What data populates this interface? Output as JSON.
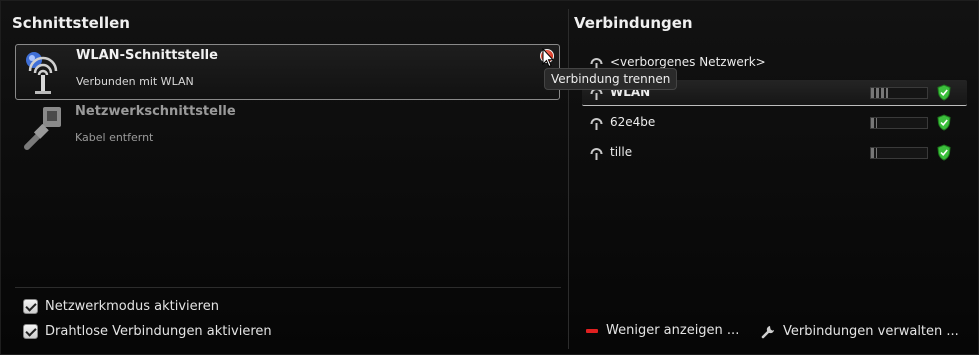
{
  "left_panel": {
    "title": "Schnittstellen",
    "interfaces": [
      {
        "name": "WLAN-Schnittstelle",
        "status": "Verbunden mit WLAN",
        "icon": "wireless-antenna-icon",
        "selected": true
      },
      {
        "name": "Netzwerkschnittstelle",
        "status": "Kabel entfernt",
        "icon": "ethernet-cable-icon",
        "selected": false
      }
    ],
    "tooltip": "Verbindung trennen",
    "checkboxes": [
      {
        "label": "Netzwerkmodus aktivieren",
        "checked": true
      },
      {
        "label": "Drahtlose Verbindungen aktivieren",
        "checked": true
      }
    ]
  },
  "right_panel": {
    "title": "Verbindungen",
    "connections": [
      {
        "name": "<verborgenes Netzwerk>",
        "icon": "wifi-signal-icon"
      },
      {
        "name": "WLAN",
        "icon": "wifi-signal-icon",
        "signal": 0.3,
        "secured": true,
        "active": true
      },
      {
        "name": "62e4be",
        "icon": "wifi-signal-icon",
        "signal": 0.1,
        "secured": true
      },
      {
        "name": "tille",
        "icon": "wifi-signal-icon",
        "signal": 0.1,
        "secured": true
      }
    ],
    "less_label": "Weniger anzeigen ...",
    "manage_label": "Verbindungen verwalten ..."
  },
  "colors": {
    "accent_red": "#e02020",
    "shield_green": "#3cbf3c"
  }
}
